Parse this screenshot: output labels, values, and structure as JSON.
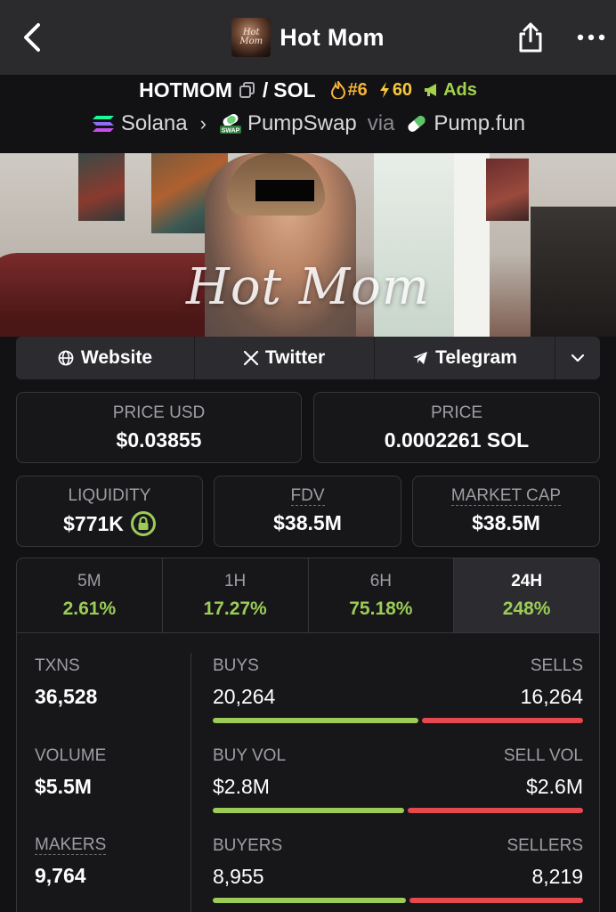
{
  "nav": {
    "title": "Hot Mom",
    "avatar_text": "Hot Mom",
    "back_icon": "chevron-left-icon",
    "share_icon": "share-icon",
    "more_icon": "more-icon"
  },
  "pair": {
    "base": "HOTMOM",
    "separator": "/",
    "quote": "SOL",
    "rank": "#6",
    "boost": "60",
    "ads": "Ads"
  },
  "chain": {
    "network": "Solana",
    "dex": "PumpSwap",
    "via": "via",
    "launchpad": "Pump.fun"
  },
  "banner": {
    "text": "Hot Mom"
  },
  "links": [
    {
      "label": "Website",
      "icon": "globe-icon"
    },
    {
      "label": "Twitter",
      "icon": "x-icon"
    },
    {
      "label": "Telegram",
      "icon": "telegram-icon"
    }
  ],
  "prices": {
    "price_usd_label": "PRICE USD",
    "price_usd": "$0.03855",
    "price_label": "PRICE",
    "price": "0.0002261 SOL"
  },
  "metrics": {
    "liquidity_label": "LIQUIDITY",
    "liquidity": "$771K",
    "fdv_label": "FDV",
    "fdv": "$38.5M",
    "mcap_label": "MARKET CAP",
    "mcap": "$38.5M"
  },
  "timeframes": [
    {
      "label": "5M",
      "change": "2.61%"
    },
    {
      "label": "1H",
      "change": "17.27%"
    },
    {
      "label": "6H",
      "change": "75.18%"
    },
    {
      "label": "24H",
      "change": "248%",
      "active": true
    }
  ],
  "stats": {
    "txns_label": "TXNS",
    "txns": "36,528",
    "buys_label": "BUYS",
    "buys": "20,264",
    "sells_label": "SELLS",
    "sells": "16,264",
    "buys_ratio": 0.555,
    "volume_label": "VOLUME",
    "volume": "$5.5M",
    "buy_vol_label": "BUY VOL",
    "buy_vol": "$2.8M",
    "sell_vol_label": "SELL VOL",
    "sell_vol": "$2.6M",
    "buy_vol_ratio": 0.518,
    "makers_label": "MAKERS",
    "makers": "9,764",
    "buyers_label": "BUYERS",
    "buyers": "8,955",
    "sellers_label": "SELLERS",
    "sellers": "8,219",
    "buyers_ratio": 0.522
  },
  "colors": {
    "positive": "#9ccc57",
    "negative": "#e5484d",
    "rank": "#f6b33a",
    "ads": "#a3d14f"
  }
}
